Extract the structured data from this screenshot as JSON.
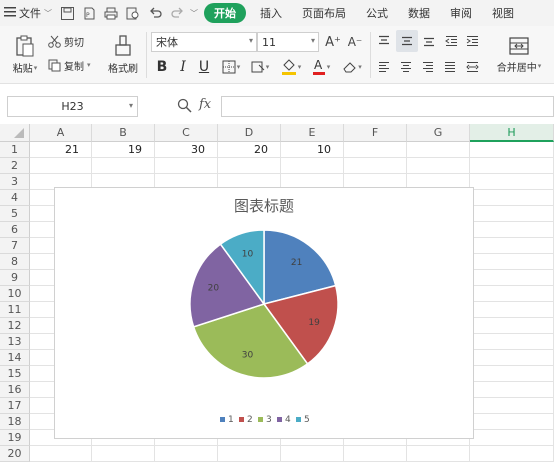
{
  "menubar": {
    "menu_label": "文件",
    "tabs": [
      {
        "label": "开始",
        "active": true
      },
      {
        "label": "插入"
      },
      {
        "label": "页面布局"
      },
      {
        "label": "公式"
      },
      {
        "label": "数据"
      },
      {
        "label": "审阅"
      },
      {
        "label": "视图"
      }
    ]
  },
  "toolbar": {
    "paste_label": "粘贴",
    "cut_label": "剪切",
    "copy_label": "复制",
    "format_painter_label": "格式刷",
    "font_name": "宋体",
    "font_size": "11",
    "bold": "B",
    "italic": "I",
    "underline": "U",
    "increase_font": "A⁺",
    "decrease_font": "A⁻",
    "merge_label": "合并居中",
    "font_color": "#e02020",
    "fill_color": "#f5c400"
  },
  "formula": {
    "name_box": "H23",
    "fx": "fx",
    "value": ""
  },
  "sheet": {
    "columns": [
      "A",
      "B",
      "C",
      "D",
      "E",
      "F",
      "G",
      "H"
    ],
    "selected_column": "H",
    "rows": [
      "1",
      "2",
      "3",
      "4",
      "5",
      "6",
      "7",
      "8",
      "9",
      "10",
      "11",
      "12",
      "13",
      "14",
      "15",
      "16",
      "17",
      "18",
      "19",
      "20"
    ],
    "row1_values": [
      "21",
      "19",
      "30",
      "20",
      "10"
    ]
  },
  "chart": {
    "title": "图表标题",
    "legend_position": "bottom"
  },
  "chart_data": {
    "type": "pie",
    "title": "图表标题",
    "categories": [
      "1",
      "2",
      "3",
      "4",
      "5"
    ],
    "values": [
      21,
      19,
      30,
      20,
      10
    ],
    "colors": [
      "#4f81bd",
      "#c0504d",
      "#9bbb59",
      "#8064a2",
      "#4bacc6"
    ]
  }
}
